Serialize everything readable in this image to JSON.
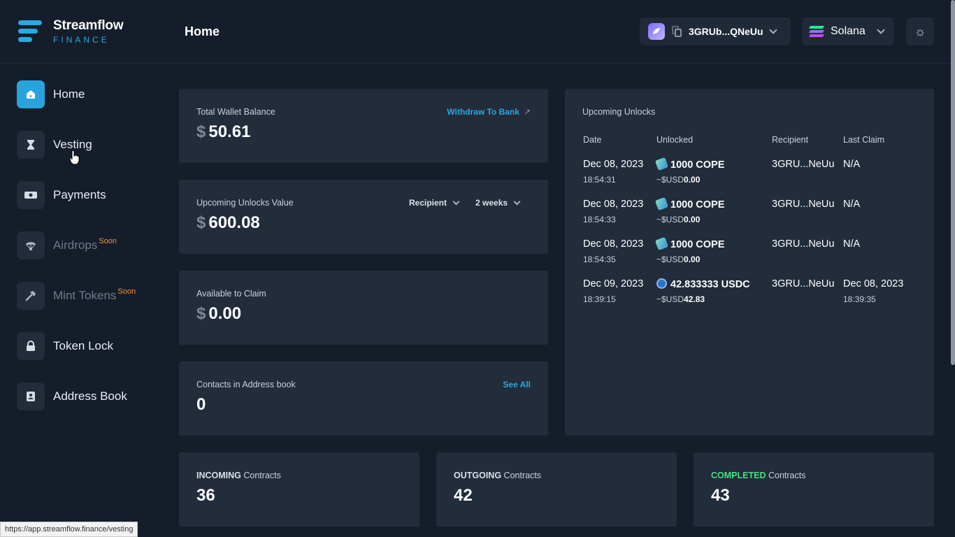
{
  "brand": {
    "name": "Streamflow",
    "sub": "FINANCE"
  },
  "header": {
    "title": "Home",
    "wallet_address": "3GRUb...QNeUu",
    "network": "Solana"
  },
  "sidebar": {
    "items": [
      {
        "label": "Home",
        "badge": ""
      },
      {
        "label": "Vesting",
        "badge": ""
      },
      {
        "label": "Payments",
        "badge": ""
      },
      {
        "label": "Airdrops",
        "badge": "Soon"
      },
      {
        "label": "Mint Tokens",
        "badge": "Soon"
      },
      {
        "label": "Token Lock",
        "badge": ""
      },
      {
        "label": "Address Book",
        "badge": ""
      }
    ]
  },
  "wallet_balance": {
    "label": "Total Wallet Balance",
    "currency": "$",
    "value": "50.61",
    "link": "Withdraw To Bank"
  },
  "upcoming_value": {
    "label": "Upcoming Unlocks Value",
    "currency": "$",
    "value": "600.08",
    "filter_role": "Recipient",
    "filter_period": "2 weeks"
  },
  "available": {
    "label": "Available to Claim",
    "currency": "$",
    "value": "0.00"
  },
  "contacts": {
    "label": "Contacts in Address book",
    "value": "0",
    "link": "See All"
  },
  "contracts": [
    {
      "tag": "INCOMING",
      "label": "Contracts",
      "value": "36",
      "color": "#d9e0ea"
    },
    {
      "tag": "OUTGOING",
      "label": "Contracts",
      "value": "42",
      "color": "#d9e0ea"
    },
    {
      "tag": "COMPLETED",
      "label": "Contracts",
      "value": "43",
      "color": "#4ade80"
    }
  ],
  "upcoming_unlocks": {
    "title": "Upcoming Unlocks",
    "columns": [
      "Date",
      "Unlocked",
      "Recipient",
      "Last Claim"
    ],
    "rows": [
      {
        "date": "Dec 08, 2023",
        "time": "18:54:31",
        "icon": "cope-token-icon",
        "amount": "1000 COPE",
        "usd_prefix": "~$USD",
        "usd": "0.00",
        "recipient": "3GRU...NeUu",
        "last_claim": "N/A",
        "last_claim_time": ""
      },
      {
        "date": "Dec 08, 2023",
        "time": "18:54:33",
        "icon": "cope-token-icon",
        "amount": "1000 COPE",
        "usd_prefix": "~$USD",
        "usd": "0.00",
        "recipient": "3GRU...NeUu",
        "last_claim": "N/A",
        "last_claim_time": ""
      },
      {
        "date": "Dec 08, 2023",
        "time": "18:54:35",
        "icon": "cope-token-icon",
        "amount": "1000 COPE",
        "usd_prefix": "~$USD",
        "usd": "0.00",
        "recipient": "3GRU...NeUu",
        "last_claim": "N/A",
        "last_claim_time": ""
      },
      {
        "date": "Dec 09, 2023",
        "time": "18:39:15",
        "icon": "usdc-token-icon",
        "amount": "42.833333 USDC",
        "usd_prefix": "~$USD",
        "usd": "42.83",
        "recipient": "3GRU...NeUu",
        "last_claim": "Dec 08, 2023",
        "last_claim_time": "18:39:35"
      }
    ]
  },
  "status_bar": {
    "url": "https://app.streamflow.finance/vesting"
  }
}
